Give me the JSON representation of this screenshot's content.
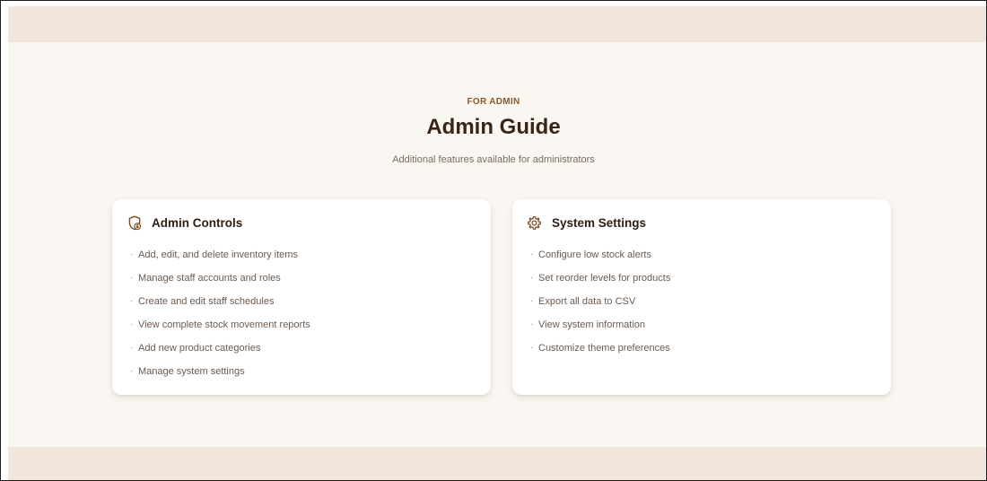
{
  "section": {
    "eyebrow": "FOR ADMIN",
    "title": "Admin Guide",
    "subtitle": "Additional features available for administrators"
  },
  "cards": [
    {
      "title": "Admin Controls",
      "icon": "shield-lock-icon",
      "items": [
        "Add, edit, and delete inventory items",
        "Manage staff accounts and roles",
        "Create and edit staff schedules",
        "View complete stock movement reports",
        "Add new product categories",
        "Manage system settings"
      ]
    },
    {
      "title": "System Settings",
      "icon": "gear-icon",
      "items": [
        "Configure low stock alerts",
        "Set reorder levels for products",
        "Export all data to CSV",
        "View system information",
        "Customize theme preferences"
      ]
    }
  ],
  "colors": {
    "background": "#faf7f2",
    "band": "#f2e6dc",
    "eyebrow": "#8a5a2e",
    "title": "#3b2416",
    "icon": "#7a4a22",
    "card": "#ffffff"
  }
}
